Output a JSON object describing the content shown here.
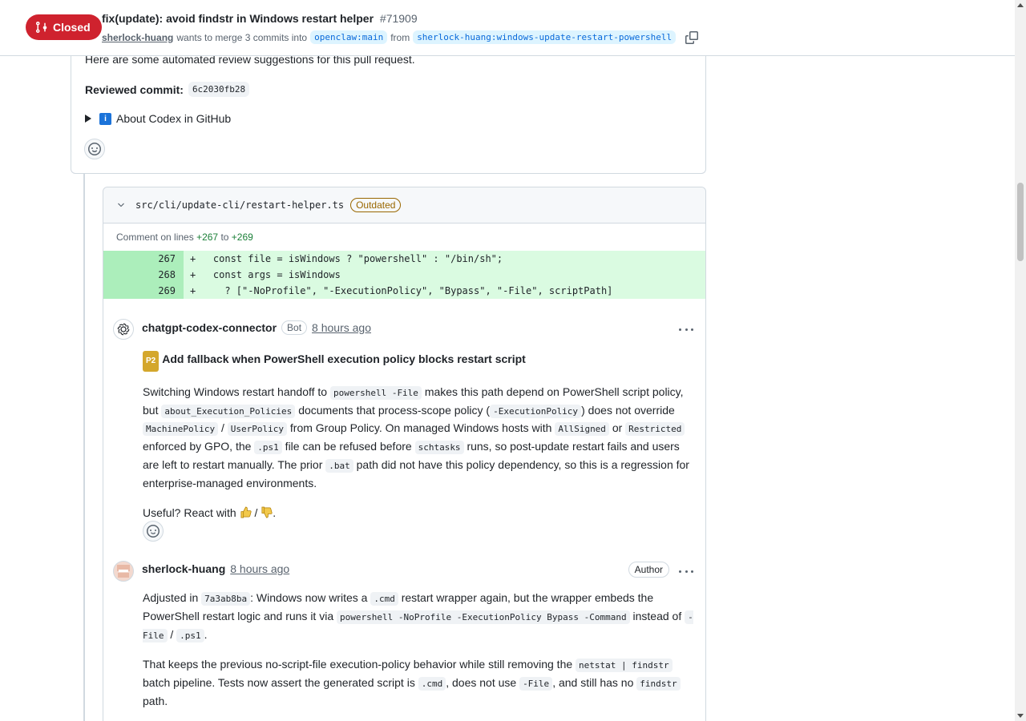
{
  "header": {
    "state": "Closed",
    "title": "fix(update): avoid findstr in Windows restart helper",
    "number": "#71909",
    "author": "sherlock-huang",
    "merge_text": "wants to merge 3 commits into",
    "base_branch": "openclaw:main",
    "from_text": "from",
    "head_branch": "sherlock-huang:windows-update-restart-powershell",
    "state_color": "#cf222e"
  },
  "review": {
    "intro": "Here are some automated review suggestions for this pull request.",
    "reviewed_commit_label": "Reviewed commit:",
    "reviewed_commit_sha": "6c2030fb28",
    "about_codex": "About Codex in GitHub"
  },
  "thread": {
    "file_path": "src/cli/update-cli/restart-helper.ts",
    "outdated_label": "Outdated",
    "comment_on_lines": "Comment on lines",
    "line_from": "+267",
    "to_text": "to",
    "line_to": "+269",
    "diff": [
      {
        "ln": "267",
        "code": "+   const file = isWindows ? \"powershell\" : \"/bin/sh\";"
      },
      {
        "ln": "268",
        "code": "+   const args = isWindows"
      },
      {
        "ln": "269",
        "code": "+     ? [\"-NoProfile\", \"-ExecutionPolicy\", \"Bypass\", \"-File\", scriptPath]"
      }
    ]
  },
  "comment1": {
    "author": "chatgpt-codex-connector",
    "bot_label": "Bot",
    "time": "8 hours ago",
    "priority": "P2",
    "title": "Add fallback when PowerShell execution policy blocks restart script",
    "t1": "Switching Windows restart handoff to ",
    "c1": "powershell -File",
    "t2": " makes this path depend on PowerShell script policy, but ",
    "c2": "about_Execution_Policies",
    "t3": " documents that process-scope policy (",
    "c3": "-ExecutionPolicy",
    "t4": ") does not override ",
    "c4": "MachinePolicy",
    "t5": " / ",
    "c5": "UserPolicy",
    "t6": " from Group Policy. On managed Windows hosts with ",
    "c6": "AllSigned",
    "t7": " or ",
    "c7": "Restricted",
    "t8": " enforced by GPO, the ",
    "c8": ".ps1",
    "t9": " file can be refused before ",
    "c9": "schtasks",
    "t10": " runs, so post-update restart fails and users are left to restart manually. The prior ",
    "c10": ".bat",
    "t11": " path did not have this policy dependency, so this is a regression for enterprise-managed environments.",
    "useful": "Useful? React with",
    "slash": "/",
    "period": "."
  },
  "comment2": {
    "author": "sherlock-huang",
    "time": "8 hours ago",
    "author_label": "Author",
    "p1_t1": "Adjusted in ",
    "p1_c1": "7a3ab8ba",
    "p1_t2": ": Windows now writes a ",
    "p1_c2": ".cmd",
    "p1_t3": " restart wrapper again, but the wrapper embeds the PowerShell restart logic and runs it via ",
    "p1_c3": "powershell -NoProfile -ExecutionPolicy Bypass -Command",
    "p1_t4": " instead of ",
    "p1_c4": "-File",
    "p1_t5": " / ",
    "p1_c5": ".ps1",
    "p1_t6": ".",
    "p2_t1": "That keeps the previous no-script-file execution-policy behavior while still removing the ",
    "p2_c1": "netstat | findstr",
    "p2_t2": " batch pipeline. Tests now assert the generated script is ",
    "p2_c2": ".cmd",
    "p2_t3": ", does not use ",
    "p2_c3": "-File",
    "p2_t4": ", and still has no ",
    "p2_c4": "findstr",
    "p2_t5": " path."
  }
}
